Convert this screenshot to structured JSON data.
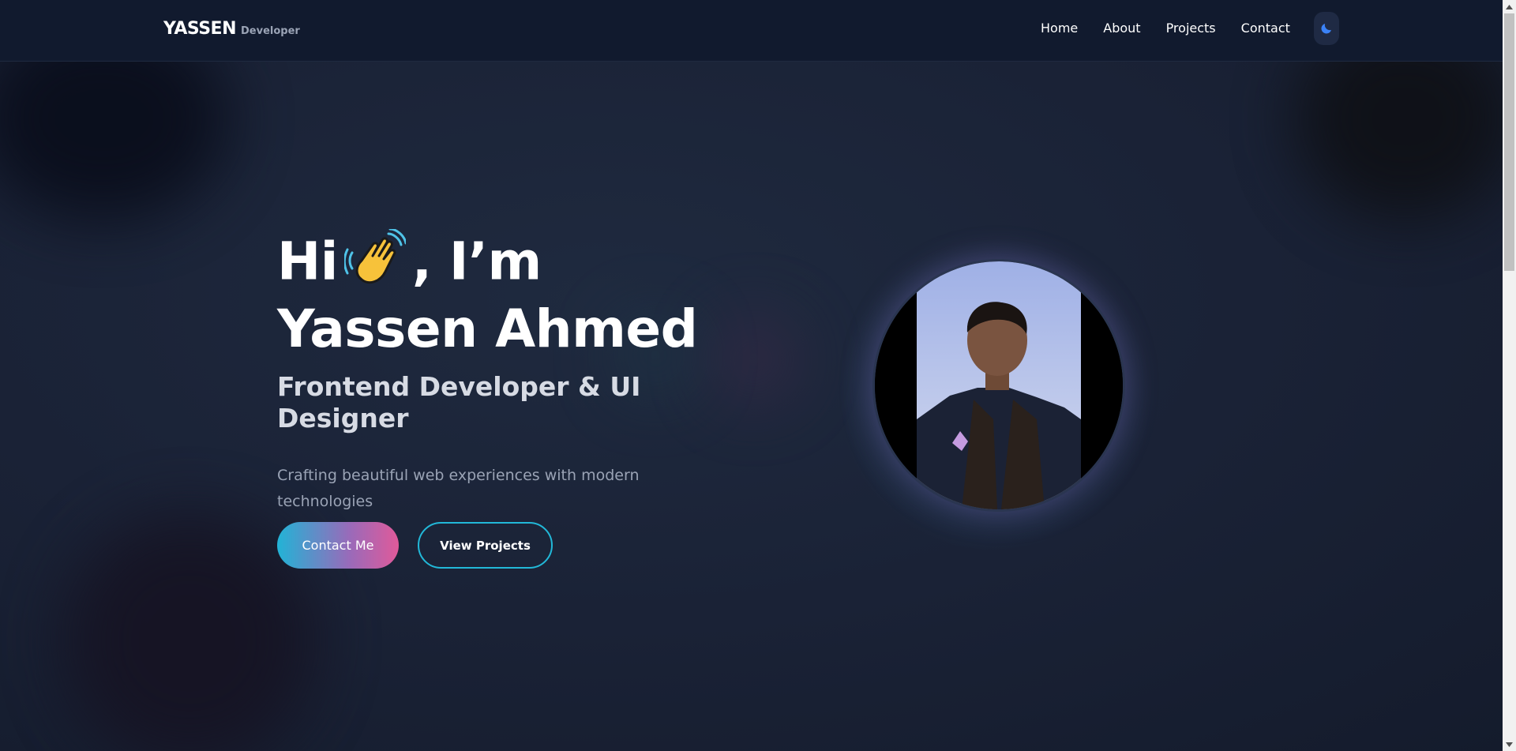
{
  "header": {
    "brand_name": "YASSEN",
    "brand_sub": "Developer",
    "nav": [
      "Home",
      "About",
      "Projects",
      "Contact"
    ],
    "theme_icon": "moon-icon"
  },
  "hero": {
    "greeting_pre": "Hi",
    "greeting_post": ", I’m",
    "wave_icon": "waving-hand-icon",
    "name": "Yassen Ahmed",
    "role": "Frontend Developer & UI Designer",
    "tagline": "Crafting beautiful web experiences with modern technologies",
    "primary_cta": "Contact Me",
    "secondary_cta": "View Projects"
  },
  "colors": {
    "background": "#1a2236",
    "header": "#111a2e",
    "accent_cyan": "#22b8d8",
    "accent_pink": "#e05a9a",
    "moon": "#3b82f6"
  }
}
